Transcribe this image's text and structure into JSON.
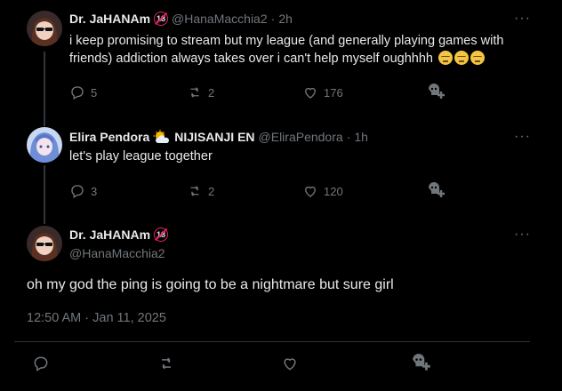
{
  "tweets": [
    {
      "name": "Dr. JaHANAm",
      "badge": "18",
      "handle": "@HanaMacchia2",
      "sep": "·",
      "time": "2h",
      "text": "i keep promising to stream but my league (and generally playing games with friends) addiction always takes over i can't help myself oughhhh",
      "emoji_count": 3,
      "replies": "5",
      "reposts": "2",
      "likes": "176"
    },
    {
      "name": "Elira Pendora",
      "org": "NIJISANJI EN",
      "handle": "@EliraPendora",
      "sep": "·",
      "time": "1h",
      "text": "let's play league together",
      "replies": "3",
      "reposts": "2",
      "likes": "120"
    }
  ],
  "focused": {
    "name": "Dr. JaHANAm",
    "badge": "18",
    "handle": "@HanaMacchia2",
    "text": "oh my god the ping is going to be a nightmare but sure girl",
    "timestamp": "12:50 AM · Jan 11, 2025"
  },
  "more_glyph": "···",
  "colors": {
    "background": "#000000",
    "text": "#e7e9ea",
    "muted": "#71767b",
    "badge_ring": "#e0245e"
  }
}
